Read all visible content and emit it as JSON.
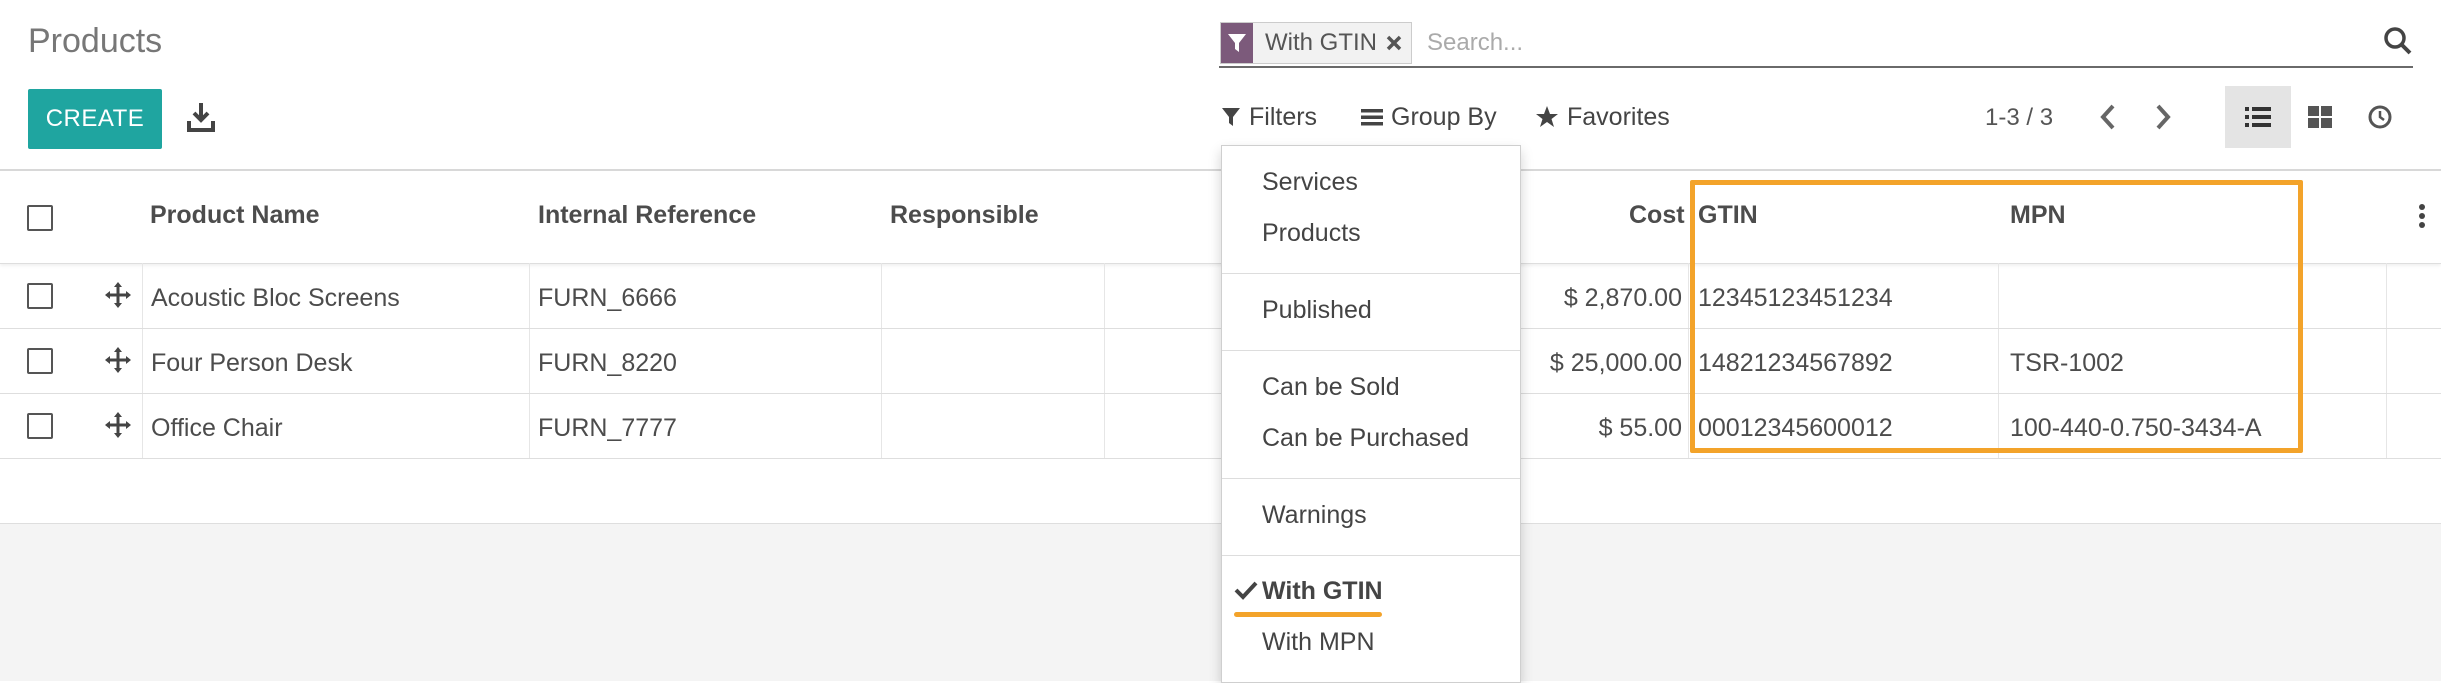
{
  "breadcrumb": {
    "title": "Products"
  },
  "toolbar": {
    "create_label": "CREATE",
    "download_icon": "download-icon"
  },
  "search": {
    "facet_icon": "filter-icon",
    "facet_label": "With GTIN",
    "placeholder": "Search...",
    "value": ""
  },
  "control_panel": {
    "filters_label": "Filters",
    "group_by_label": "Group By",
    "favorites_label": "Favorites",
    "pager": "1-3 / 3",
    "active_view": "list"
  },
  "table": {
    "columns": [
      "Product Name",
      "Internal Reference",
      "Responsible",
      "Cost",
      "GTIN",
      "MPN"
    ],
    "rows": [
      {
        "name": "Acoustic Bloc Screens",
        "ref": "FURN_6666",
        "responsible": "",
        "cost": "$ 2,870.00",
        "gtin": "12345123451234",
        "mpn": ""
      },
      {
        "name": "Four Person Desk",
        "ref": "FURN_8220",
        "responsible": "",
        "cost": "$ 25,000.00",
        "gtin": "14821234567892",
        "mpn": "TSR-1002"
      },
      {
        "name": "Office Chair",
        "ref": "FURN_7777",
        "responsible": "",
        "cost": "$ 55.00",
        "gtin": "00012345600012",
        "mpn": "100-440-0.750-3434-A"
      }
    ]
  },
  "filters_menu": {
    "items": [
      "Services",
      "Products",
      "Published",
      "Can be Sold",
      "Can be Purchased",
      "Warnings",
      "With GTIN",
      "With MPN"
    ],
    "checked": "With GTIN"
  },
  "colors": {
    "primary": "#1fa5a0",
    "facet": "#7c5a7b",
    "highlight": "#f3a32a"
  }
}
